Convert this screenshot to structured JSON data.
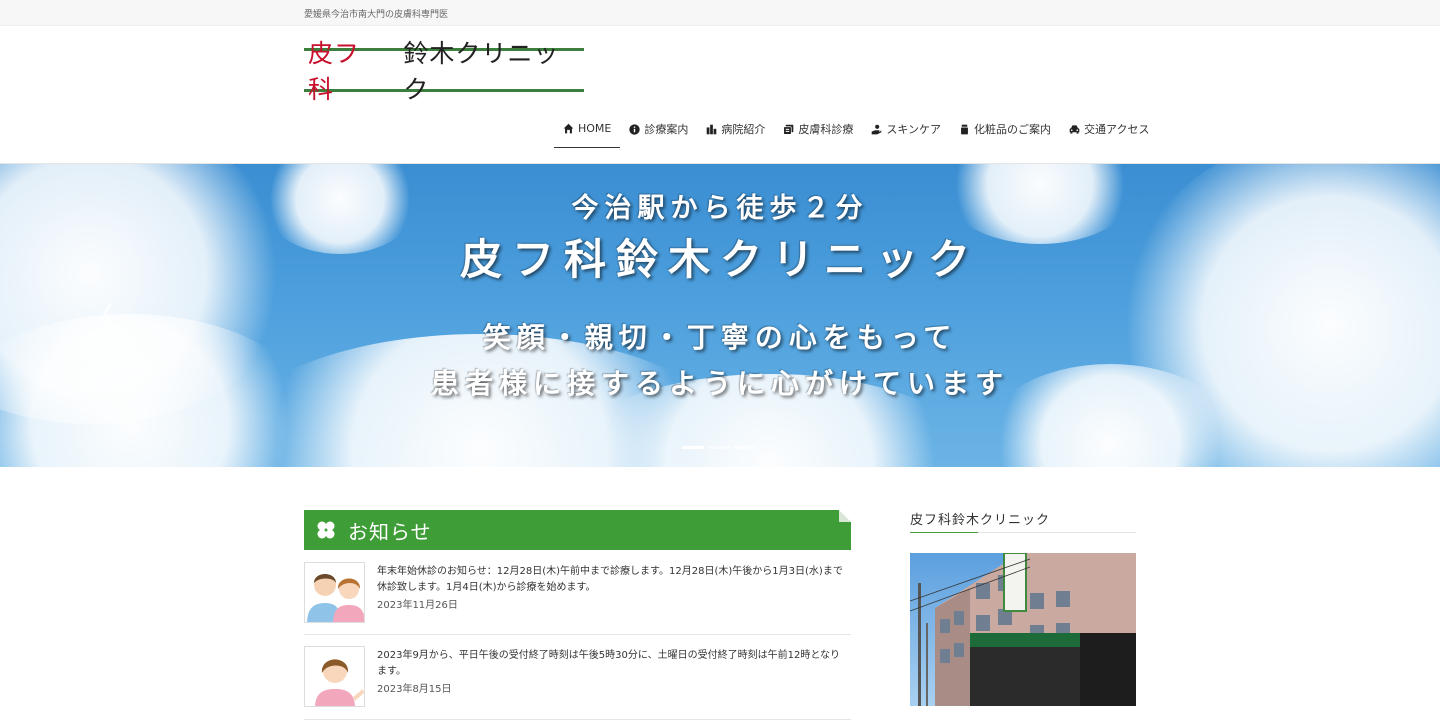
{
  "topbar": {
    "tagline": "愛媛県今治市南大門の皮膚科専門医"
  },
  "logo": {
    "red_text": "皮フ科",
    "black_text": "鈴木クリニック"
  },
  "nav": {
    "items": [
      {
        "label": "HOME",
        "icon": "home-icon"
      },
      {
        "label": "診療案内",
        "icon": "info-icon"
      },
      {
        "label": "病院紹介",
        "icon": "building-icon"
      },
      {
        "label": "皮膚科診療",
        "icon": "clipboard-icon"
      },
      {
        "label": "スキンケア",
        "icon": "hand-care-icon"
      },
      {
        "label": "化粧品のご案内",
        "icon": "bottle-icon"
      },
      {
        "label": "交通アクセス",
        "icon": "car-icon"
      }
    ]
  },
  "hero": {
    "line1": "今治駅から徒歩２分",
    "line2": "皮フ科鈴木クリニック",
    "line3": "笑顔・親切・丁寧の心をもって",
    "line4": "患者様に接するように心がけています"
  },
  "news": {
    "title": "お知らせ",
    "items": [
      {
        "text": "年末年始休診のお知らせ：12月28日(木)午前中まで診療します。12月28日(木)午後から1月3日(水)まで休診致します。1月4日(木)から診療を始めます。",
        "date": "2023年11月26日"
      },
      {
        "text": "2023年9月から、平日午後の受付終了時刻は午後5時30分に、土曜日の受付終了時刻は午前12時となります。",
        "date": "2023年8月15日"
      }
    ]
  },
  "sidebar": {
    "title": "皮フ科鈴木クリニック"
  },
  "colors": {
    "accent_green": "#3f9d37",
    "logo_red": "#c8102e",
    "logo_rule": "#3c7f3c"
  }
}
